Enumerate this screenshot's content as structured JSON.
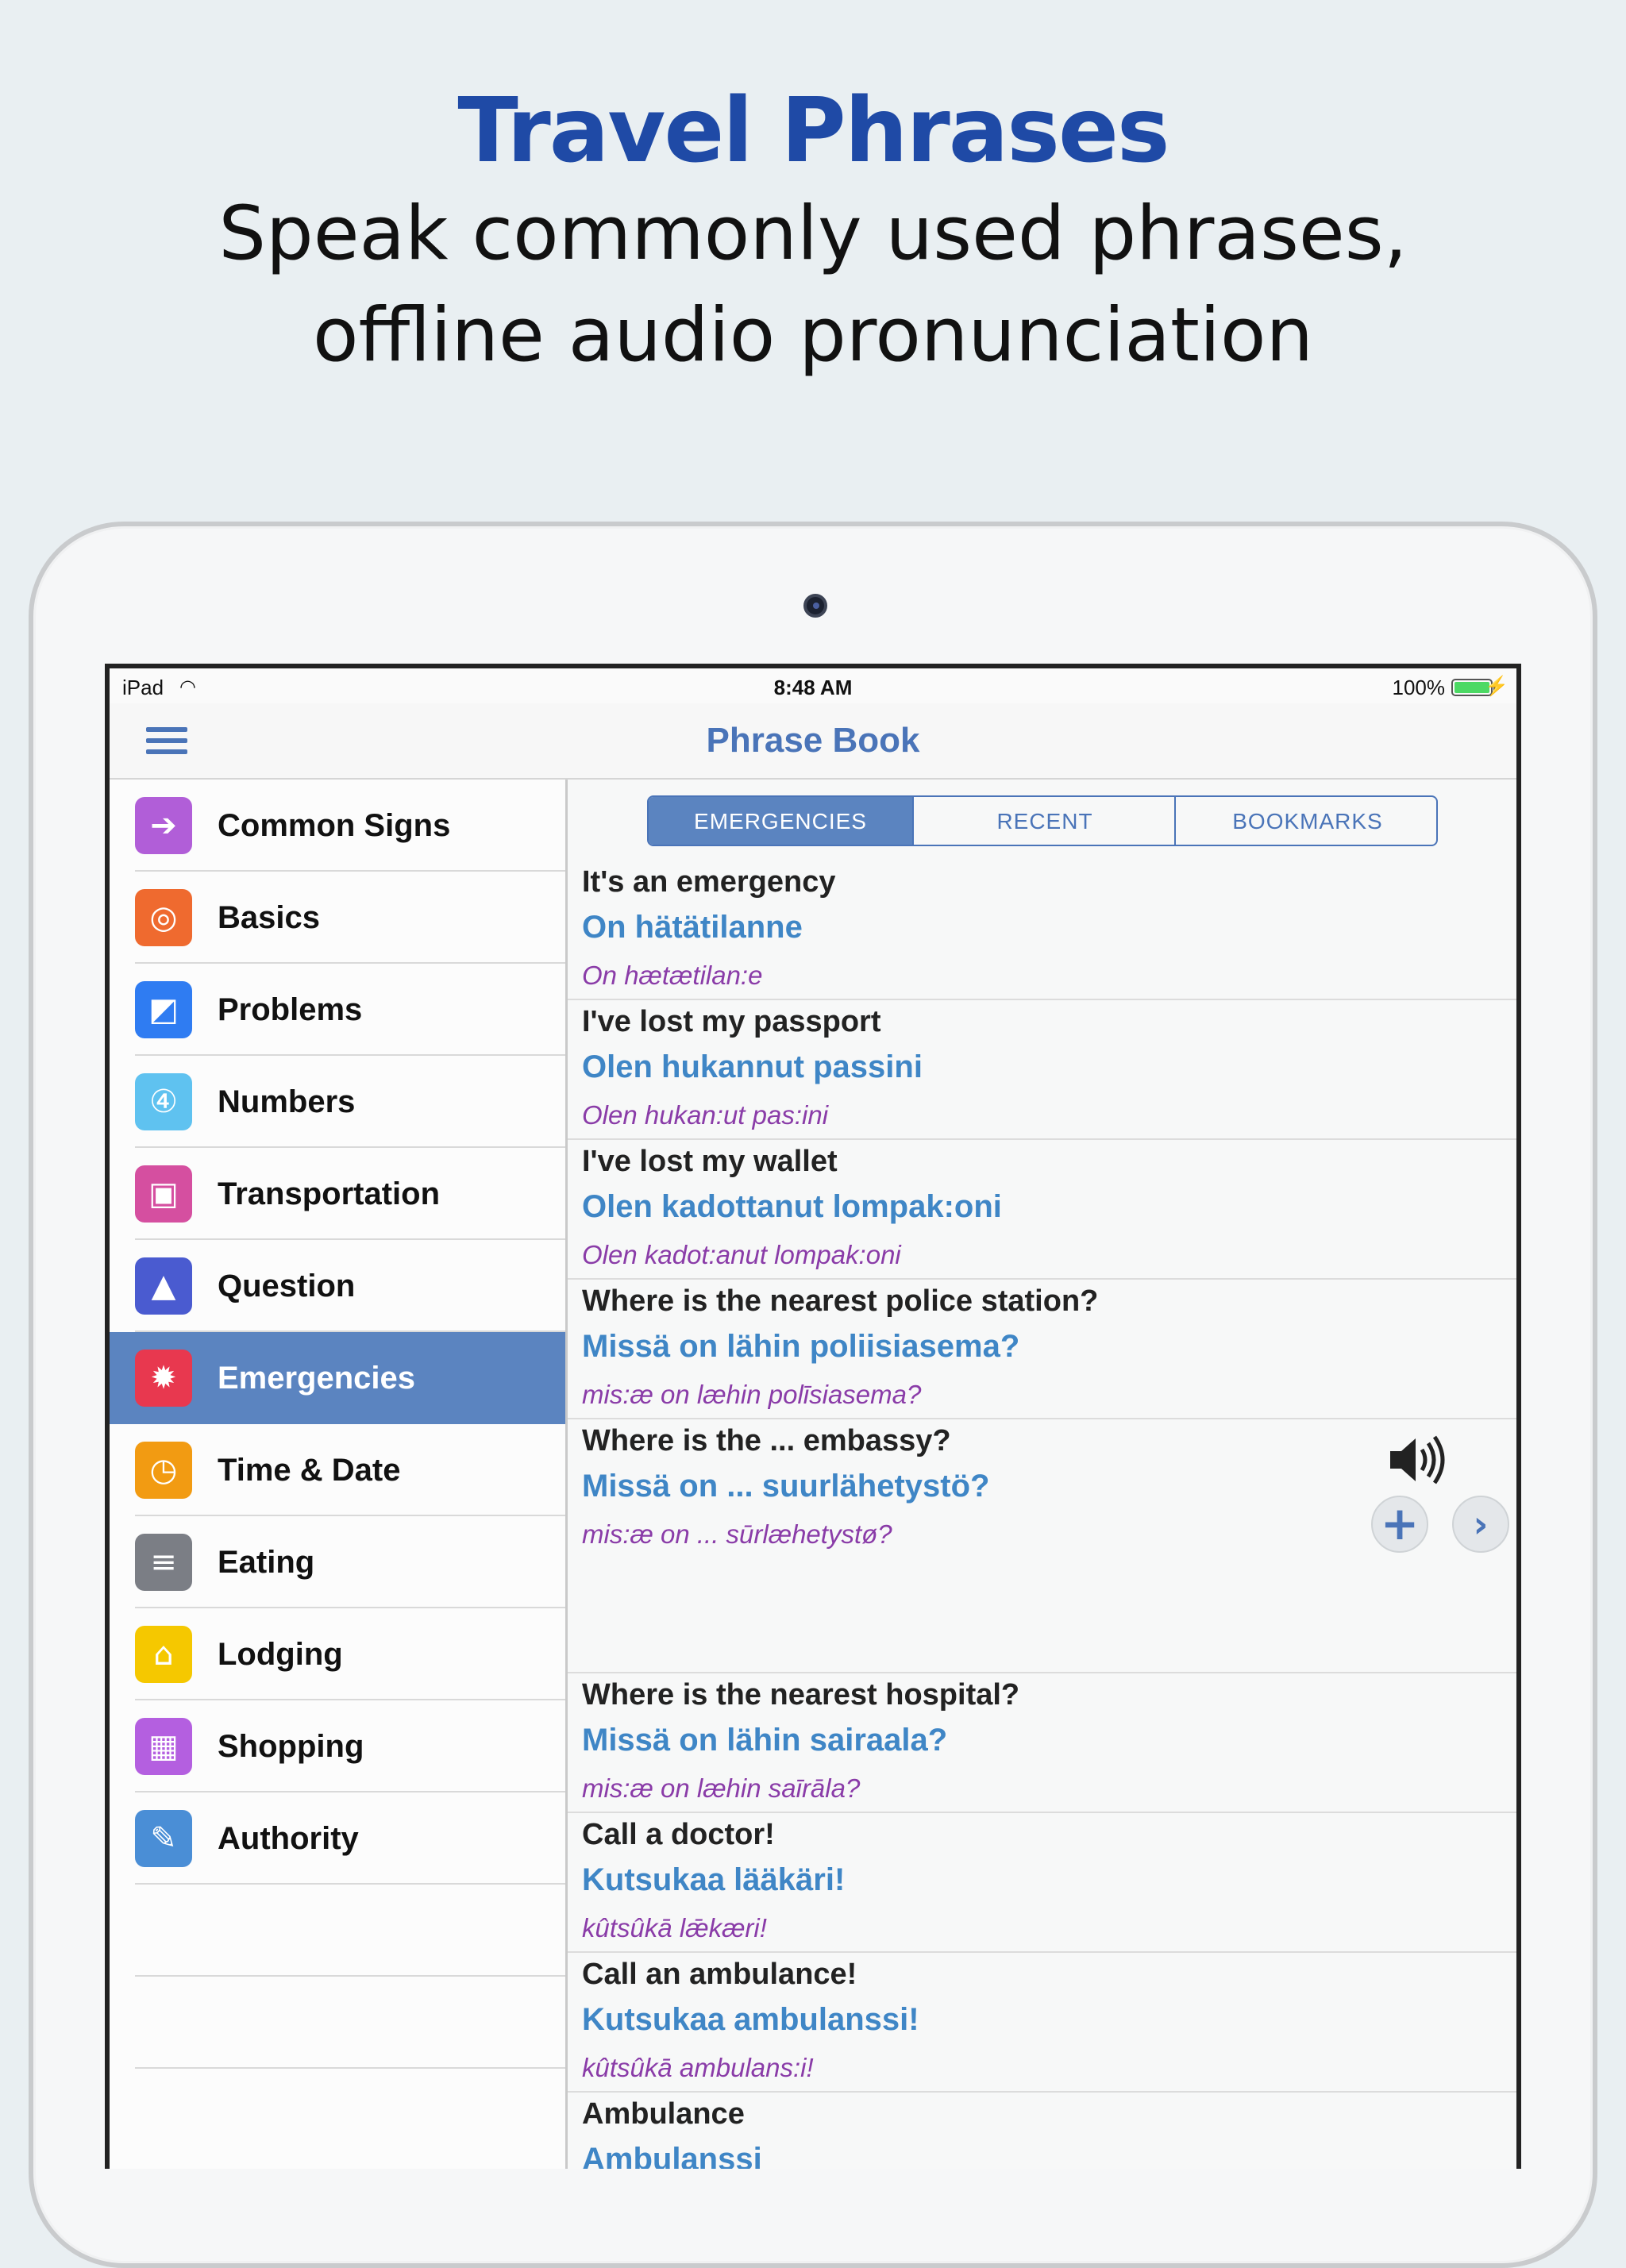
{
  "marketing": {
    "headline": "Travel Phrases",
    "subline1": "Speak commonly used phrases,",
    "subline2": "offline audio pronunciation"
  },
  "status_bar": {
    "device": "iPad",
    "time": "8:48 AM",
    "battery": "100%"
  },
  "nav": {
    "title": "Phrase Book",
    "menu_icon": "hamburger-menu-icon"
  },
  "sidebar": {
    "items": [
      {
        "label": "Common Signs",
        "icon": "sign-icon",
        "color": "#b15ed8"
      },
      {
        "label": "Basics",
        "icon": "basics-icon",
        "color": "#ef6a2f"
      },
      {
        "label": "Problems",
        "icon": "problems-icon",
        "color": "#2f7cf2"
      },
      {
        "label": "Numbers",
        "icon": "numbers-icon",
        "color": "#5fc2f0"
      },
      {
        "label": "Transportation",
        "icon": "car-icon",
        "color": "#d54fa0"
      },
      {
        "label": "Question",
        "icon": "person-icon",
        "color": "#4a5bd0"
      },
      {
        "label": "Emergencies",
        "icon": "siren-icon",
        "color": "#e8384f"
      },
      {
        "label": "Time & Date",
        "icon": "clock-icon",
        "color": "#f29b12"
      },
      {
        "label": "Eating",
        "icon": "eating-icon",
        "color": "#7b7e85"
      },
      {
        "label": "Lodging",
        "icon": "house-icon",
        "color": "#f5c800"
      },
      {
        "label": "Shopping",
        "icon": "cart-icon",
        "color": "#b45fe0"
      },
      {
        "label": "Authority",
        "icon": "quill-icon",
        "color": "#4a8ed6"
      }
    ],
    "selected_index": 6
  },
  "tabs": [
    "EMERGENCIES",
    "RECENT",
    "BOOKMARKS"
  ],
  "phrases": [
    {
      "en": "It's an emergency",
      "fi": "On hätätilanne",
      "pron": "On hætætilan:e"
    },
    {
      "en": "I've lost my passport",
      "fi": "Olen hukannut passini",
      "pron": "Olen hukan:ut pas:ini"
    },
    {
      "en": "I've lost my wallet",
      "fi": "Olen kadottanut lompak:oni",
      "pron": "Olen kadot:anut lompak:oni"
    },
    {
      "en": "Where is the nearest police station?",
      "fi": "Missä on lähin poliisiasema?",
      "pron": "mis:æ on læhin polīsiasema?"
    },
    {
      "en": "Where is the ... embassy?",
      "fi": "Missä on ... suurlähetystö?",
      "pron": "mis:æ on ... sūrlæhetystø?"
    },
    {
      "en": "Where is the nearest hospital?",
      "fi": "Missä on lähin sairaala?",
      "pron": "mis:æ on læhin saīrāla?"
    },
    {
      "en": "Call a doctor!",
      "fi": "Kutsukaa lääkäri!",
      "pron": "kûtsûkā lǣkæri!"
    },
    {
      "en": "Call an ambulance!",
      "fi": "Kutsukaa ambulanssi!",
      "pron": "kûtsûkā ambulans:i!"
    },
    {
      "en": "Ambulance",
      "fi": "Ambulanssi",
      "pron": ""
    }
  ],
  "actions": {
    "speaker_icon": "speaker-icon",
    "add_icon": "plus-icon",
    "next_icon": "chevron-right-icon"
  }
}
